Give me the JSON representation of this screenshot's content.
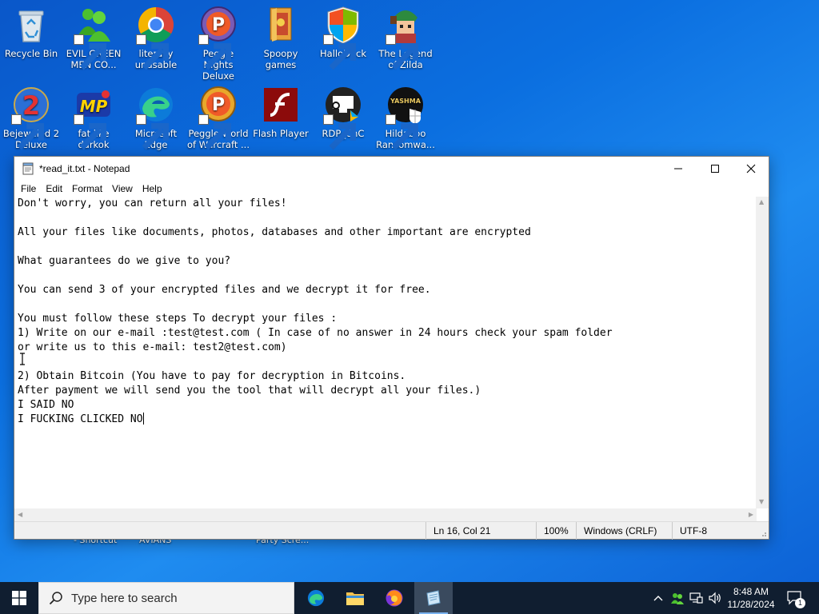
{
  "desktop": {
    "icons": [
      {
        "label": "Recycle Bin"
      },
      {
        "label": "EVIL GREEN MEN CO..."
      },
      {
        "label": "literally unusable"
      },
      {
        "label": "Peggle Nights Deluxe"
      },
      {
        "label": "Spoopy games"
      },
      {
        "label": "HalloDock"
      },
      {
        "label": "The Legend of Zilda"
      },
      {
        "label": "Bejeweled 2 Deluxe"
      },
      {
        "label": "fat like darkok"
      },
      {
        "label": "Microsoft Edge"
      },
      {
        "label": "Peggle World of Warcraft ..."
      },
      {
        "label": "Flash Player"
      },
      {
        "label": "RDP_CnC"
      },
      {
        "label": "Hildaboo Ransomwa..."
      }
    ],
    "partial_labels": [
      "- Shortcut",
      "AVIANS",
      "Party Scre..."
    ]
  },
  "notepad": {
    "title": "*read_it.txt - Notepad",
    "menu": [
      "File",
      "Edit",
      "Format",
      "View",
      "Help"
    ],
    "lines": [
      "Don't worry, you can return all your files!",
      "",
      "All your files like documents, photos, databases and other important are encrypted",
      "",
      "What guarantees do we give to you?",
      "",
      "You can send 3 of your encrypted files and we decrypt it for free.",
      "",
      "You must follow these steps To decrypt your files :",
      "1) Write on our e-mail :test@test.com ( In case of no answer in 24 hours check your spam folder",
      "or write us to this e-mail: test2@test.com)",
      "",
      "2) Obtain Bitcoin (You have to pay for decryption in Bitcoins.",
      "After payment we will send you the tool that will decrypt all your files.)",
      "I SAID NO",
      "I FUCKING CLICKED NO"
    ],
    "status": {
      "position": "Ln 16, Col 21",
      "zoom": "100%",
      "line_ending": "Windows (CRLF)",
      "encoding": "UTF-8"
    }
  },
  "taskbar": {
    "search_placeholder": "Type here to search",
    "apps": [
      "edge-icon",
      "file-explorer-icon",
      "firefox-icon",
      "notepad-icon"
    ],
    "clock": {
      "time": "8:48 AM",
      "date": "11/28/2024"
    },
    "notifications_count": "1"
  },
  "colors": {
    "desktop_blue": "#0b6fe0",
    "taskbar": "#101e30",
    "notepad_bg": "#ffffff"
  }
}
